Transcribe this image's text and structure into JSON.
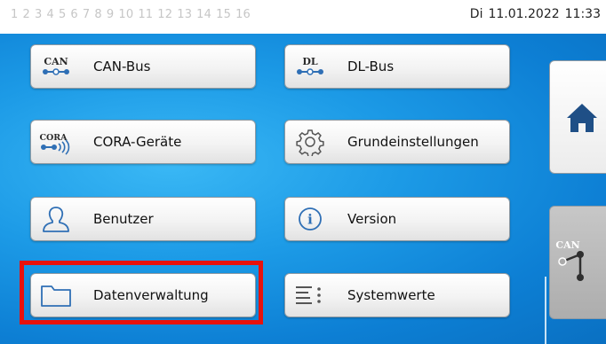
{
  "topbar": {
    "pages": [
      "1",
      "2",
      "3",
      "4",
      "5",
      "6",
      "7",
      "8",
      "9",
      "10",
      "11",
      "12",
      "13",
      "14",
      "15",
      "16"
    ],
    "day": "Di",
    "date": "11.01.2022",
    "time": "11:33"
  },
  "menu": [
    {
      "label": "CAN-Bus",
      "icon": "can-bus-icon",
      "icon_text": "CAN"
    },
    {
      "label": "DL-Bus",
      "icon": "dl-bus-icon",
      "icon_text": "DL"
    },
    {
      "label": "CORA-Geräte",
      "icon": "cora-devices-icon",
      "icon_text": "CORA"
    },
    {
      "label": "Grundeinstellungen",
      "icon": "gear-icon"
    },
    {
      "label": "Benutzer",
      "icon": "user-icon"
    },
    {
      "label": "Version",
      "icon": "info-icon",
      "icon_text": "i"
    },
    {
      "label": "Datenverwaltung",
      "icon": "folder-icon"
    },
    {
      "label": "Systemwerte",
      "icon": "list-icon"
    }
  ],
  "sidebar": {
    "home_icon": "home-icon",
    "can_label": "CAN"
  },
  "colors": {
    "accent_blue": "#1c9ae6",
    "highlight_red": "#e8120c",
    "icon_blue": "#2f6fb5",
    "home_blue": "#1f4f86"
  }
}
